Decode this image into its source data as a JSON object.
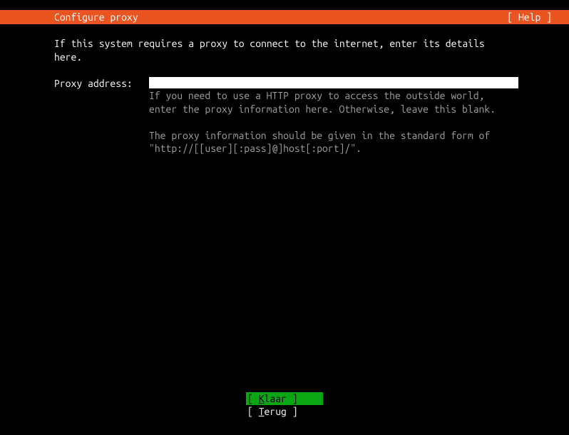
{
  "header": {
    "title": "Configure proxy",
    "help": "[ Help ]"
  },
  "content": {
    "intro": "If this system requires a proxy to connect to the internet, enter its details here.",
    "label": "Proxy address:",
    "input_value": "",
    "hint_line1": "If you need to use a HTTP proxy to access the outside world,",
    "hint_line2": "enter the proxy information here. Otherwise, leave this blank.",
    "hint_line3": "The proxy information should be given in the standard form of",
    "hint_line4": "\"http://[[user][:pass]@]host[:port]/\"."
  },
  "footer": {
    "done_open": "[ ",
    "done_letter": "K",
    "done_rest": "laar",
    "done_close": "   ]",
    "back_open": "[ ",
    "back_letter": "T",
    "back_rest": "erug",
    "back_close": "   ]"
  }
}
